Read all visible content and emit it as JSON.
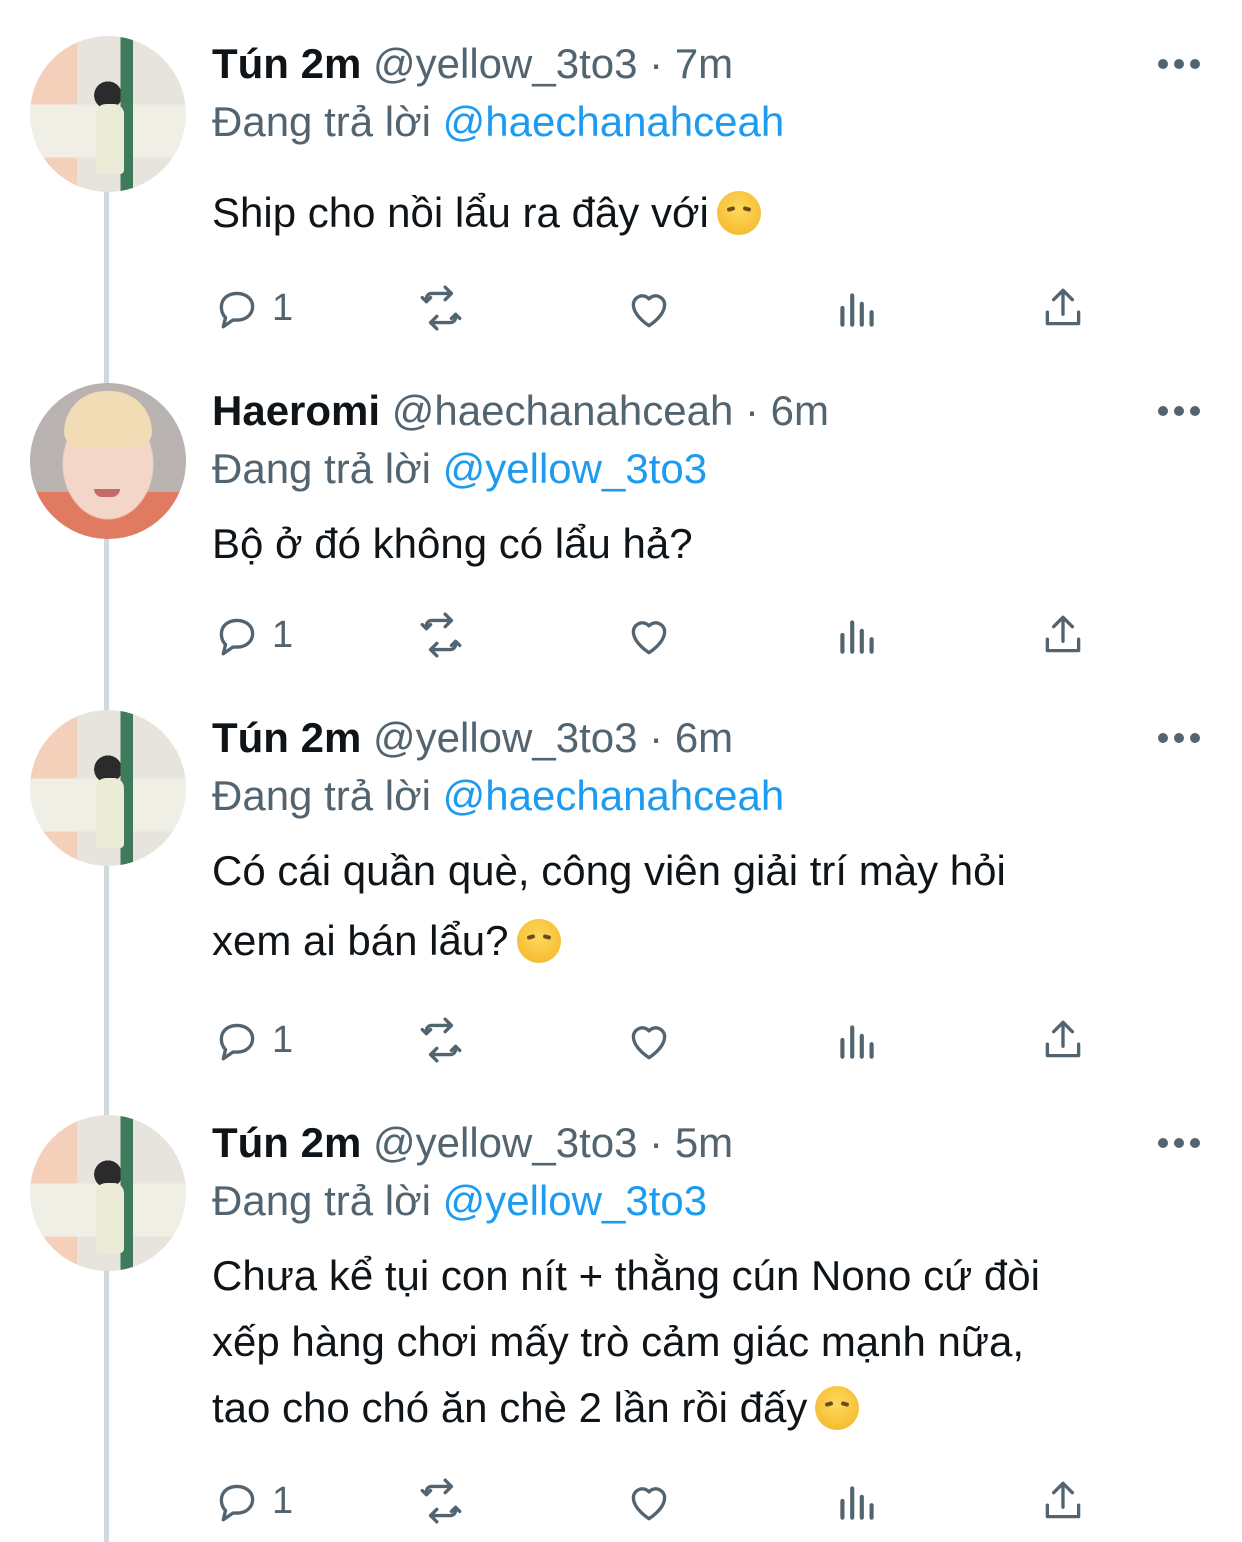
{
  "tweets": [
    {
      "name": "Tún 2m",
      "handle": "@yellow_3to3",
      "time": "7m",
      "replying_label": "Đang trả lời",
      "replying_to": "@haechanahceah",
      "lines": [
        "Ship cho nồi lẩu ra đây với"
      ],
      "emoji": "disappointed-face",
      "reply_count": "1"
    },
    {
      "name": "Haeromi",
      "handle": "@haechanahceah",
      "time": "6m",
      "replying_label": "Đang trả lời",
      "replying_to": "@yellow_3to3",
      "lines": [
        "Bộ ở đó không có lẩu hả?"
      ],
      "reply_count": "1"
    },
    {
      "name": "Tún 2m",
      "handle": "@yellow_3to3",
      "time": "6m",
      "replying_label": "Đang trả lời",
      "replying_to": "@haechanahceah",
      "lines": [
        "Có cái quần què, công viên giải trí mày hỏi",
        "xem ai bán lẩu?"
      ],
      "emoji": "disappointed-face",
      "reply_count": "1"
    },
    {
      "name": "Tún 2m",
      "handle": "@yellow_3to3",
      "time": "5m",
      "replying_label": "Đang trả lời",
      "replying_to": "@yellow_3to3",
      "lines": [
        "Chưa kể tụi con nít + thằng cún Nono cứ đòi",
        "xếp hàng chơi mấy trò cảm giác mạnh nữa,",
        "tao cho chó ăn chè 2 lần rồi đấy"
      ],
      "emoji": "pensive-face",
      "reply_count": "1"
    }
  ],
  "icons": [
    "reply-icon",
    "retweet-icon",
    "like-icon",
    "analytics-icon",
    "share-icon",
    "more-icon"
  ],
  "colors": {
    "accent": "#1d9bf0",
    "muted": "#536471",
    "text": "#0f1419",
    "thread_line": "#cfd9de"
  }
}
